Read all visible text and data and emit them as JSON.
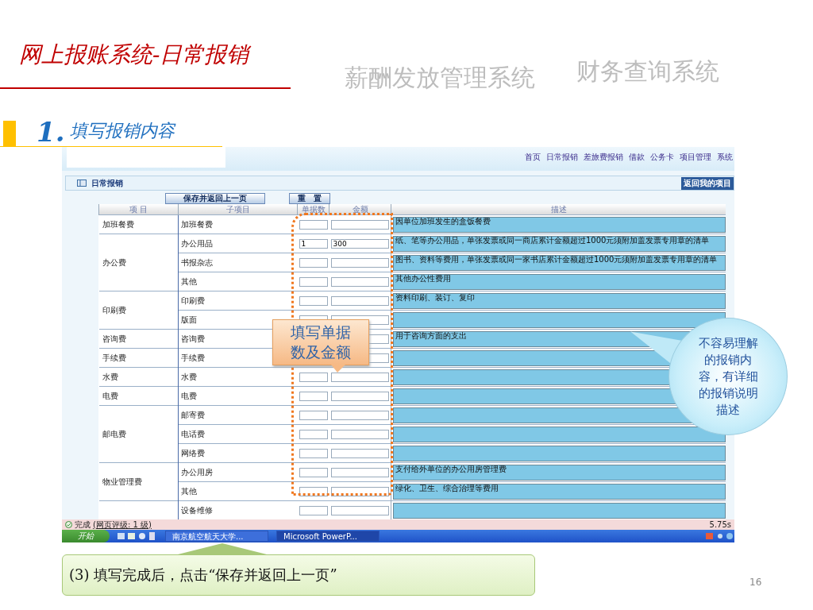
{
  "slide": {
    "title": "网上报账系统-日常报销",
    "tabs": [
      {
        "label": "薪酬发放管理系统"
      },
      {
        "label": "财务查询系统"
      }
    ],
    "step_number": "1.",
    "step_title": "填写报销内容",
    "page_number": "16"
  },
  "browser": {
    "nav": [
      "首页",
      "日常报销",
      "差旅费报销",
      "借款",
      "公务卡",
      "项目管理",
      "系统"
    ],
    "section_title": "日常报销",
    "back_button": "返回我的项目",
    "buttons": [
      "保存并返回上一页",
      "重　置"
    ],
    "columns": [
      "项 目",
      "子项目",
      "单据数",
      "金额",
      "描述"
    ],
    "categories": [
      {
        "name": "加班餐费",
        "items": [
          {
            "name": "加班餐费",
            "description": "因单位加班发生的盒饭餐费"
          }
        ]
      },
      {
        "name": "办公费",
        "items": [
          {
            "name": "办公用品",
            "count": "1",
            "amount": "300",
            "description": "纸、笔等办公用品，单张发票或同一商店累计金额超过1000元须附加盖发票专用章的清单"
          },
          {
            "name": "书报杂志",
            "description": "图书、资料等费用，单张发票或同一家书店累计金额超过1000元须附加盖发票专用章的清单"
          },
          {
            "name": "其他",
            "description": "其他办公性费用"
          }
        ]
      },
      {
        "name": "印刷费",
        "items": [
          {
            "name": "印刷费",
            "description": "资料印刷、装订、复印"
          },
          {
            "name": "版面"
          }
        ]
      },
      {
        "name": "咨询费",
        "items": [
          {
            "name": "咨询费",
            "description": "用于咨询方面的支出"
          }
        ]
      },
      {
        "name": "手续费",
        "items": [
          {
            "name": "手续费"
          }
        ]
      },
      {
        "name": "水费",
        "items": [
          {
            "name": "水费"
          }
        ]
      },
      {
        "name": "电费",
        "items": [
          {
            "name": "电费"
          }
        ]
      },
      {
        "name": "邮电费",
        "items": [
          {
            "name": "邮寄费"
          },
          {
            "name": "电话费"
          },
          {
            "name": "网络费"
          }
        ]
      },
      {
        "name": "物业管理费",
        "items": [
          {
            "name": "办公用房",
            "description": "支付给外单位的办公用房管理费"
          },
          {
            "name": "其他",
            "description": "绿化、卫生、综合治理等费用"
          }
        ]
      },
      {
        "items": [
          {
            "name": "设备维修"
          }
        ]
      }
    ],
    "status": {
      "text": "完成",
      "link": "(网页评级: 1 级)",
      "time": "5.75s"
    },
    "taskbar": {
      "start": "开始",
      "tasks": [
        "南京航空航天大学...",
        "Microsoft PowerP..."
      ]
    }
  },
  "callouts": {
    "fill_hint": "填写单据数及金额",
    "bubble": "不容易理解的报销内容，有详细的报销说明描述",
    "footer": "(3) 填写完成后，点击“保存并返回上一页”"
  }
}
